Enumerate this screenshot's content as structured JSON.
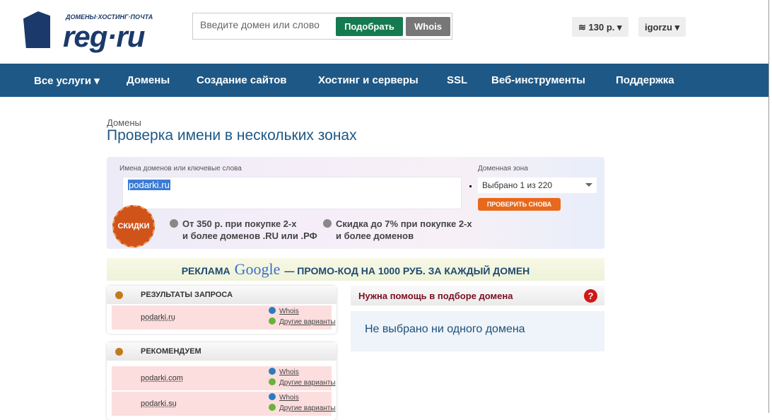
{
  "header": {
    "logo_tagline": "ДОМЕНЫ·ХОСТИНГ·ПОЧТА",
    "logo_name": "reg·ru",
    "search_placeholder": "Введите домен или слово",
    "pick_label": "Подобрать",
    "whois_label": "Whois",
    "balance": "130 р.",
    "user": "igorzu"
  },
  "nav": [
    "Все услуги ▾",
    "Домены",
    "Создание сайтов",
    "Хостинг и серверы",
    "SSL",
    "Веб-инструменты",
    "Поддержка"
  ],
  "breadcrumb": "Домены",
  "title": "Проверка имени в нескольких зонах",
  "form": {
    "names_label": "Имена доменов или ключевые слова",
    "names_value": "podarki.ru",
    "zone_label": "Доменная зона",
    "zone_value": "Выбрано 1 из 220",
    "recheck": "ПРОВЕРИТЬ СНОВА",
    "badge": "СКИДКИ",
    "promo1_a": "От 350 р. при покупке 2-х",
    "promo1_b": "и более доменов .RU или .РФ",
    "promo2_a": "Скидка до 7% при покупке 2-х",
    "promo2_b": "и более доменов"
  },
  "ad": {
    "prefix": "РЕКЛАМА",
    "brand": "Google",
    "text": "— ПРОМО-КОД НА 1000 РУБ. ЗА КАЖДЫЙ ДОМЕН"
  },
  "results": {
    "title": "РЕЗУЛЬТАТЫ ЗАПРОСА",
    "rows": [
      {
        "domain": "podarki.ru",
        "whois": "Whois",
        "other": "Другие варианты"
      }
    ]
  },
  "recommend": {
    "title": "РЕКОМЕНДУЕМ",
    "rows": [
      {
        "domain": "podarki.com",
        "whois": "Whois",
        "other": "Другие варианты"
      },
      {
        "domain": "podarki.su",
        "whois": "Whois",
        "other": "Другие варианты"
      }
    ]
  },
  "help": {
    "title": "Нужна помощь в подборе домена",
    "icon": "?",
    "empty": "Не выбрано ни одного домена"
  }
}
